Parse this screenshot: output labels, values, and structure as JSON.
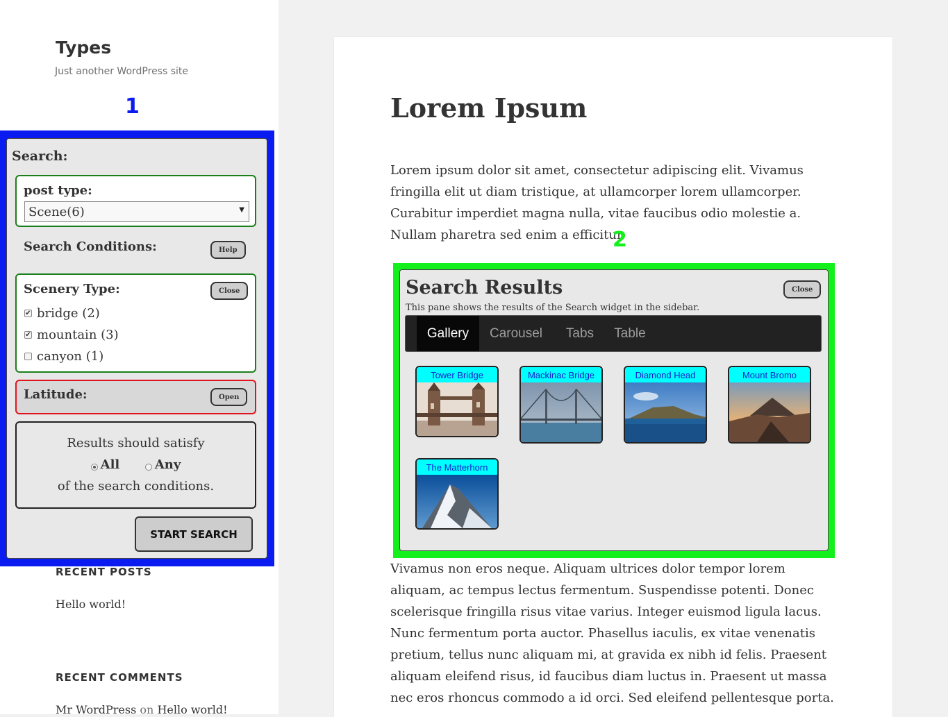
{
  "site": {
    "title": "Types",
    "tagline": "Just another WordPress site"
  },
  "callouts": {
    "one": "1",
    "two": "2"
  },
  "search_widget": {
    "heading": "Search:",
    "post_type": {
      "label": "post type:",
      "selected": "Scene(6)"
    },
    "conditions_label": "Search Conditions:",
    "help_label": "Help",
    "scenery": {
      "label": "Scenery Type:",
      "close_label": "Close",
      "options": [
        {
          "label": "bridge (2)",
          "checked": true
        },
        {
          "label": "mountain (3)",
          "checked": true
        },
        {
          "label": "canyon (1)",
          "checked": false
        }
      ]
    },
    "latitude": {
      "label": "Latitude:",
      "open_label": "Open"
    },
    "satisfy": {
      "line1": "Results should satisfy",
      "all_label": "All",
      "any_label": "Any",
      "selected": "All",
      "line2": "of the search conditions."
    },
    "start_label": "START SEARCH"
  },
  "recent_posts": {
    "heading": "RECENT POSTS",
    "items": [
      "Hello world!"
    ]
  },
  "recent_comments": {
    "heading": "RECENT COMMENTS",
    "author": "Mr WordPress",
    "on": "on",
    "post": "Hello world!"
  },
  "article": {
    "title": "Lorem Ipsum",
    "para1": "Lorem ipsum dolor sit amet, consectetur adipiscing elit. Vivamus fringilla elit ut diam tristique, at ullamcorper lorem ullamcorper. Curabitur imperdiet magna nulla, vitae faucibus odio molestie a. Nullam pharetra sed enim a efficitur.",
    "para2": "Vivamus non eros neque. Aliquam ultrices dolor tempor lorem aliquam, ac tempus lectus fermentum. Suspendisse potenti. Donec scelerisque fringilla risus vitae varius. Integer euismod ligula lacus. Nunc fermentum porta auctor. Phasellus iaculis, ex vitae venenatis pretium, tellus nunc aliquam mi, at gravida ex nibh id felis. Praesent aliquam eleifend risus, id faucibus diam luctus in. Praesent ut massa nec eros rhoncus commodo a id orci. Sed eleifend pellentesque porta."
  },
  "results": {
    "title": "Search Results",
    "close_label": "Close",
    "subtitle": "This pane shows the results of the Search widget in the sidebar.",
    "tabs": [
      "Gallery",
      "Carousel",
      "Tabs",
      "Table"
    ],
    "active_tab": "Gallery",
    "items": [
      "Tower Bridge",
      "Mackinac Bridge",
      "Diamond Head",
      "Mount Bromo",
      "The Matterhorn"
    ]
  },
  "colors": {
    "callout_blue": "#0a1bf2",
    "callout_green": "#14f01c",
    "box_green": "#1a7f1a",
    "box_red": "#e0141e",
    "thumb_caption_bg": "#00ffff"
  }
}
